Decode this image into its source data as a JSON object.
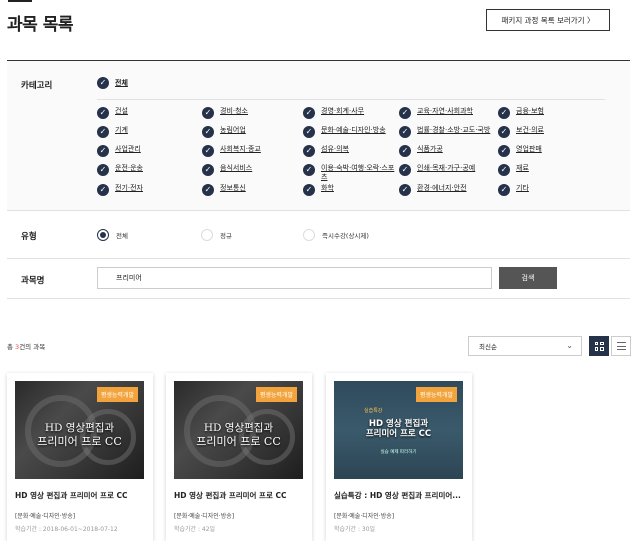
{
  "page": {
    "title": "과목 목록",
    "package_button": "패키지 과정 목록 보러가기 〉"
  },
  "filter": {
    "category_label": "카테고리",
    "all_label": "전체",
    "categories": [
      "건설",
      "경비·청소",
      "경영·회계·사무",
      "교육·자연·사회과학",
      "금융·보험",
      "기계",
      "농림어업",
      "문화·예술·디자인·방송",
      "법률·경찰·소방·교도·국방",
      "보건·의료",
      "사업관리",
      "사회복지·종교",
      "섬유·의복",
      "식품가공",
      "영업판매",
      "운전·운송",
      "음식서비스",
      "이용·숙박·여행·오락·스포츠",
      "인쇄·목재·가구·공예",
      "재료",
      "전기·전자",
      "정보통신",
      "화학",
      "환경·에너지·안전",
      "기타"
    ],
    "type_label": "유형",
    "types": [
      "전체",
      "정규",
      "즉시수강(상시제)"
    ],
    "name_label": "과목명",
    "search_value": "프리미어",
    "search_button": "검색"
  },
  "results": {
    "count_prefix": "총 ",
    "count": "3",
    "count_suffix": "건의 과목",
    "sort": "최신순",
    "icons": {
      "grid": "grid-view-icon",
      "list": "list-view-icon",
      "sort": "chevron-down-icon",
      "check": "check-icon"
    }
  },
  "courses": [
    {
      "badge": "평생능력개발",
      "thumb_line1": "HD 영상편집과",
      "thumb_line2": "프리미어 프로 CC",
      "title": "HD 영상 편집과 프리미어 프로 CC",
      "category": "[문화·예술·디자인·방송]",
      "period": "학습기간 : 2018-06-01~2018-07-12"
    },
    {
      "badge": "평생능력개발",
      "thumb_line1": "HD 영상편집과",
      "thumb_line2": "프리미어 프로 CC",
      "title": "HD 영상 편집과 프리미어 프로 CC",
      "category": "[문화·예술·디자인·방송]",
      "period": "학습기간 : 42일"
    },
    {
      "badge": "평생능력개발",
      "tag": "실습특강",
      "thumb_line1": "HD 영상 편집과",
      "thumb_line2": "프리미어 프로 CC",
      "thumb_sub": "실습 예제 따라하기",
      "title": "실습특강 : HD 영상 편집과 프리미어...",
      "category": "[문화·예술·디자인·방송]",
      "period": "학습기간 : 30일"
    }
  ],
  "colors": {
    "accent": "#25324a",
    "badge": "#f2a33c",
    "count": "#d9534f",
    "search_button": "#555555"
  }
}
